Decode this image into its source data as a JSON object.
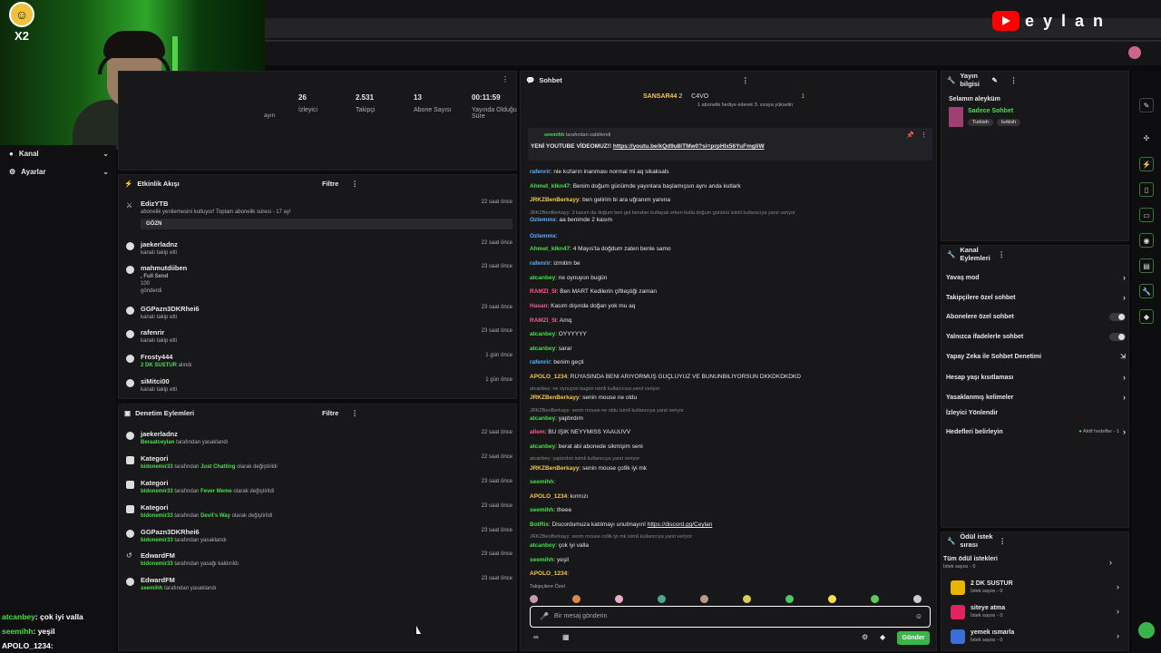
{
  "stream": {
    "channel_name": "eylan",
    "badge": "X2"
  },
  "sidebar": {
    "items": [
      {
        "label": "Kanal"
      },
      {
        "label": "Ayarlar"
      }
    ]
  },
  "stats": {
    "partial_label": "ayın",
    "items": [
      {
        "value": "26",
        "label": "İzleyici"
      },
      {
        "value": "2.531",
        "label": "Takipçi"
      },
      {
        "value": "13",
        "label": "Abone Sayısı"
      },
      {
        "value": "00:11:59",
        "label": "Yayında Olduğu Süre"
      }
    ]
  },
  "activity": {
    "title": "Etkinlik Akışı",
    "filter": "Filtre",
    "events": [
      {
        "user": "EdizYTB",
        "desc": "abonelik yenilemesini kutluyor! Toplam abonelik süresi - 17 ay!",
        "extra": "GÖZN",
        "time": "22 saat önce"
      },
      {
        "user": "jaekerladnz",
        "desc": "kanalı takip etti",
        "time": "22 saat önce"
      },
      {
        "user": "mahmutdiiben",
        "desc": ", Full Send",
        "desc2": "100",
        "desc3": "gönderdi",
        "time": "23 saat önce"
      },
      {
        "user": "GGPazn3DKRhei6",
        "desc": "kanalı takip etti",
        "time": "23 saat önce"
      },
      {
        "user": "rafenrir",
        "desc": "kanalı takip etti",
        "time": "23 saat önce"
      },
      {
        "user": "Frosty444",
        "desc_green": "2 DK SUSTUR",
        "desc": "alındı",
        "time": "1 gün önce"
      },
      {
        "user": "siMitci00",
        "desc": "kanalı takip etti",
        "time": "1 gün önce"
      }
    ]
  },
  "moderation": {
    "title": "Denetim Eylemleri",
    "filter": "Filtre",
    "events": [
      {
        "user": "jaekerladnz",
        "by": "Beraatceylan",
        "rest": "tarafından yasaklandı",
        "time": "22 saat önce"
      },
      {
        "user": "Kategori",
        "by": "bidonemir33",
        "rest": "tarafından",
        "cat": "Just Chatting",
        "rest2": "olarak değiştirildi",
        "time": "22 saat önce"
      },
      {
        "user": "Kategori",
        "by": "bidonemir33",
        "rest": "tarafından",
        "cat": "Fever Meme",
        "rest2": "olarak değiştirildi",
        "time": "23 saat önce"
      },
      {
        "user": "Kategori",
        "by": "bidonemir33",
        "rest": "tarafından",
        "cat": "Devil's Way",
        "rest2": "olarak değiştirildi",
        "time": "23 saat önce"
      },
      {
        "user": "GGPazn3DKRhei6",
        "by": "bidonemir33",
        "rest": "tarafından yasaklandı",
        "time": "23 saat önce"
      },
      {
        "user": "EdwardFM",
        "by": "bidonemir33",
        "rest": "tarafından yasağı kaldırıldı",
        "time": "23 saat önce"
      },
      {
        "user": "EdwardFM",
        "by": "seemihh",
        "rest": "tarafından yasaklandı",
        "time": "23 saat önce"
      }
    ]
  },
  "chat": {
    "title": "Sohbet",
    "leader": {
      "name": "SANSAR44",
      "count": "2",
      "second": "C4VO",
      "count2": "1",
      "sub": "1 abonelik hediye ederek 3. sıraya yükselin"
    },
    "pinned": {
      "by": "seemihh",
      "by_rest": "tarafından sabitlendi",
      "text": "YENİ YOUTUBE VİDEOMUZ!!",
      "link": "https://youtu.be/kQd9u8iTMw0?si=prpHlx56YuFmgliW"
    },
    "messages": [
      {
        "user": "rafenrir",
        "cls": "u-blue",
        "text": ": nie kızların inanması normal mi aq sikaksals"
      },
      {
        "user": "Ahmet_klkn47",
        "cls": "u-green",
        "text": ": Benim doğum günümde yayınlara başlamışsın aynı anda kutlark"
      },
      {
        "user": "JRKZBenBerkayy",
        "cls": "u-yellow",
        "text": ": ben gelirim bi ara uğranım yanına"
      },
      {
        "reply": "JRKZBenBerkayy: 3 kasım da doğum ben gel beraber kutlayak erken kutla doğum gününü isimli kullanıcıya yanıt veriyor"
      },
      {
        "user": "Ozlemmx",
        "cls": "u-blue",
        "text": ": aa benimde 2 kasım"
      },
      {
        "user": "Ozlemmx",
        "cls": "u-blue",
        "text": ":"
      },
      {
        "user": "Ahmet_klkn47",
        "cls": "u-green",
        "text": ": 4 Mayıs'ta doğdum zaten benle samo"
      },
      {
        "user": "rafenrir",
        "cls": "u-blue",
        "text": ": izmitim be"
      },
      {
        "user": "atcanbey",
        "cls": "u-green",
        "text": ": ne oynuyon bugün"
      },
      {
        "user": "RAMZI_5I",
        "cls": "u-pink",
        "text": ": Ben MART Kedilerin çiftleştiği zaman"
      },
      {
        "user": "Hasan",
        "cls": "u-pink",
        "text": ": Kasım dışında doğan yok mu aq"
      },
      {
        "user": "RAMZI_5I",
        "cls": "u-pink",
        "text": ": Amq"
      },
      {
        "user": "atcanbey",
        "cls": "u-green",
        "text": ": OYYYYYY"
      },
      {
        "user": "atcanbey",
        "cls": "u-green",
        "text": ": sarar"
      },
      {
        "user": "rafenrir",
        "cls": "u-blue",
        "text": ": benim geçti"
      },
      {
        "user": "APOLO_1234",
        "cls": "u-yellow",
        "text": ": RÜYASINDA BENİ ARIYORMUŞ GÜÇLÜYÜZ VE BUNUNBİLİYORSUN DKKDKDKDKD"
      },
      {
        "reply": "atcanbey: ne oynuyon bugün isimli kullanıcıya yanıt veriyor"
      },
      {
        "user": "JRKZBenBerkayy",
        "cls": "u-yellow",
        "text": ": senin mouse ne oldu"
      },
      {
        "reply": "JRKZBenBerkayy: senin mouse ne oldu isimli kullanıcıya yanıt veriyor"
      },
      {
        "user": "atcanbey",
        "cls": "u-green",
        "text": ": yaptırdım"
      },
      {
        "user": "allem",
        "cls": "u-pink",
        "text": ": BU IŞIK NEYYMISS YAAUUVV"
      },
      {
        "user": "atcanbey",
        "cls": "u-green",
        "text": ": berat abi abonede sikmişim seni"
      },
      {
        "reply": "atcanbey: yaptırdım isimli kullanıcıya yanıt veriyor"
      },
      {
        "user": "JRKZBenBerkayy",
        "cls": "u-yellow",
        "text": ": senin mouse ço9k iyi mk"
      },
      {
        "user": "seemihh",
        "cls": "u-green",
        "text": ":"
      },
      {
        "user": "APOLO_1234",
        "cls": "u-yellow",
        "text": ": kırmızı"
      },
      {
        "user": "seemihh",
        "cls": "u-green",
        "text": ": theee"
      },
      {
        "user": "BotRix",
        "cls": "u-green",
        "text": ": Discordumuza katılmayı unutmayın!",
        "link": "https://discord.gg/Ceylan"
      },
      {
        "reply": "JRKZBenBerkayy: senin mouse co9k iyi mk isimli kullanıcıya yanıt veriyor"
      },
      {
        "user": "atcanbey",
        "cls": "u-green",
        "text": ": çok iyi valla"
      },
      {
        "user": "seemihh",
        "cls": "u-green",
        "text": ": yeşil"
      },
      {
        "user": "APOLO_1234",
        "cls": "u-yellow",
        "text": ":"
      }
    ],
    "followers_only": "Takipçilere Özel",
    "input_placeholder": "Bir mesaj gönderin",
    "send_label": "Gönder"
  },
  "stream_info": {
    "title": "Yayın bilgisi",
    "greeting": "Selamın aleyküm",
    "category": "Sadece Sohbet",
    "tags": [
      "Turkish",
      "turkish"
    ]
  },
  "channel_actions": {
    "title": "Kanal Eylemleri",
    "items": [
      {
        "label": "Yavaş mod",
        "type": "chev"
      },
      {
        "label": "Takipçilere özel sohbet",
        "type": "chev"
      },
      {
        "label": "Abonelere özel sohbet",
        "type": "toggle"
      },
      {
        "label": "Yalnızca ifadelerle sohbet",
        "type": "toggle"
      },
      {
        "label": "Yapay Zeka ile Sohbet Denetimi",
        "type": "ext"
      },
      {
        "label": "Hesap yaşı kısıtlaması",
        "type": "chev"
      },
      {
        "label": "Yasaklanmış kelimeler",
        "type": "chev"
      },
      {
        "label": "İzleyici Yönlendir",
        "type": "none"
      },
      {
        "label": "Hedefleri belirleyin",
        "type": "goal",
        "extra": "Aktif hedefler - 1"
      }
    ]
  },
  "rewards": {
    "title": "Ödül istek sırası",
    "items": [
      {
        "label": "Tüm ödül istekleri",
        "sub": "İstek sayısı - 0",
        "color": ""
      },
      {
        "label": "2 DK SUSTUR",
        "sub": "İstek sayısı - 0",
        "color": "#e8b400"
      },
      {
        "label": "siteye atma",
        "sub": "İstek sayısı - 0",
        "color": "#e0245e"
      },
      {
        "label": "yemek ısmarla",
        "sub": "İstek sayısı - 0",
        "color": "#3a6fd8"
      }
    ]
  },
  "overlay_chat": [
    {
      "user": "atcanbey",
      "text": ": çok iyi valla"
    },
    {
      "user": "seemihh",
      "text": ": yeşil"
    },
    {
      "user": "APOLO_1234",
      "text": ":"
    }
  ],
  "colors": {
    "accent": "#45e045",
    "panel": "#18181b",
    "send": "#39b54a"
  }
}
